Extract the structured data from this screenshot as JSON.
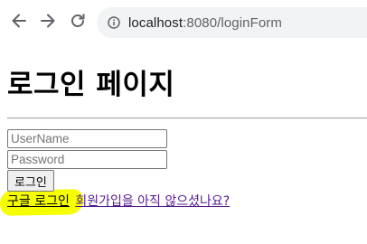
{
  "browser": {
    "url_host": "localhost",
    "url_path": ":8080/loginForm"
  },
  "page": {
    "title": "로그인 페이지",
    "username": {
      "placeholder": "UserName",
      "value": ""
    },
    "password": {
      "placeholder": "Password",
      "value": ""
    },
    "login_button_label": "로그인",
    "google_login_link": "구글 로그인",
    "signup_link": "회원가입을 아직 않으셨나요?"
  },
  "colors": {
    "highlight": "#f5ff00",
    "visited_link": "#551a8b"
  }
}
